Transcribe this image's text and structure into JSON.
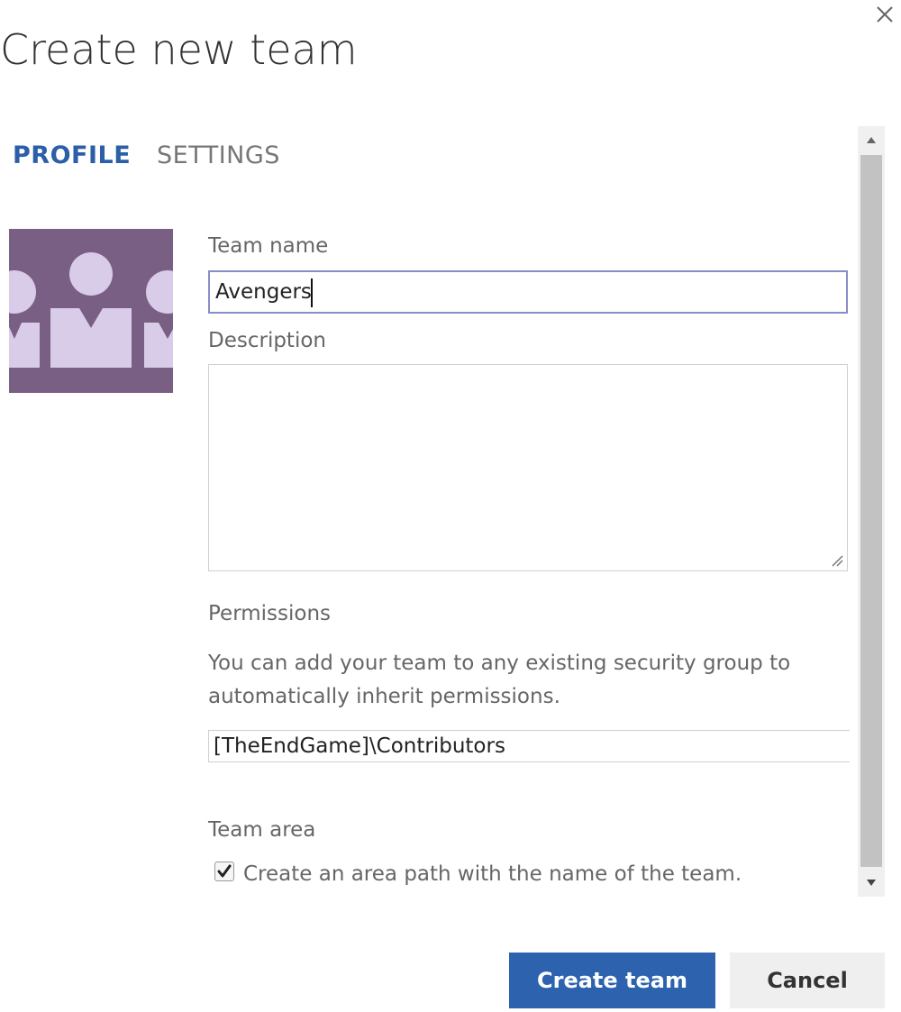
{
  "dialog": {
    "title": "Create new team",
    "close_icon": "close-icon"
  },
  "tabs": [
    {
      "label": "PROFILE",
      "active": true
    },
    {
      "label": "SETTINGS",
      "active": false
    }
  ],
  "avatar": {
    "icon": "team-members-icon",
    "background_color": "#7a5f85",
    "figure_color": "#d8cce8"
  },
  "form": {
    "team_name": {
      "label": "Team name",
      "value": "Avengers"
    },
    "description": {
      "label": "Description",
      "value": ""
    },
    "permissions": {
      "label": "Permissions",
      "help_text": "You can add your team to any existing security group to automatically inherit permissions.",
      "value": "[TheEndGame]\\Contributors"
    },
    "team_area": {
      "label": "Team area",
      "checkbox_label": "Create an area path with the name of the team.",
      "checked": true
    }
  },
  "buttons": {
    "create_label": "Create team",
    "cancel_label": "Cancel"
  },
  "colors": {
    "accent": "#2d5ea8",
    "primary_button": "#2d63ae",
    "secondary_button": "#efefef"
  }
}
